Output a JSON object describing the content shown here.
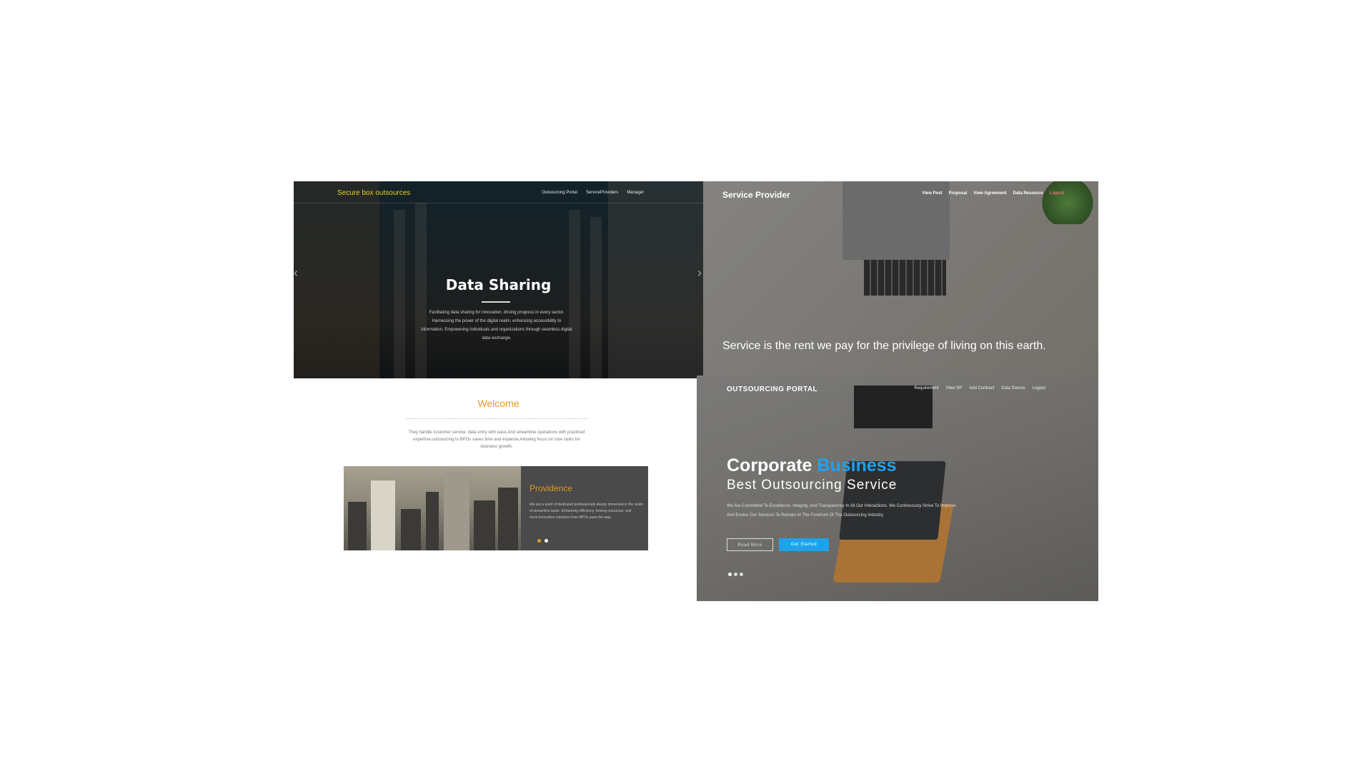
{
  "panel_secure_box": {
    "brand": "Secure box outsources",
    "nav": [
      "Outsourcing Portal",
      "ServiceProviders",
      "Manager"
    ],
    "hero_title": "Data Sharing",
    "hero_desc": "Facilitating data sharing for innovation, driving progress in every sector. Harnessing the power of the digital realm, enhancing accessibility to information. Empowering individuals and organizations through seamless digital data exchange."
  },
  "welcome": {
    "title": "Welcome",
    "desc": "They handle customer service, data entry with ease,And streamline operations with practiced expertise.outsourcing to BPOs saves time and expense,Allowing focus on core tasks for business growth."
  },
  "card": {
    "title": "Providence",
    "desc": "We are a team of dedicated professionals deeply immersed in the realm of streamline tasks. Enhancing efficiency, freeing resources, and more.Innovative solutions from BPOs pave the way.",
    "dot_colors": [
      "#e39b1f",
      "#ffffff"
    ]
  },
  "panel_service_provider": {
    "brand": "Service Provider",
    "nav": [
      "View Post",
      "Proposal",
      "View Agreement",
      "Data Resource"
    ],
    "logout": "Logout",
    "quote": "Service is the rent we pay for the privilege of living on this earth."
  },
  "panel_outsourcing": {
    "brand": "OUTSOURCING PORTAL",
    "nav": [
      "Requirement",
      "View SP",
      "Add Contract",
      "Data Source",
      "Logout"
    ],
    "headline_part1": "Corporate",
    "headline_part2": "Business",
    "subheadline": "Best Outsourcing Service",
    "desc": "We Are Committed To Excellence, Integrity, And Transparency In All Our Interactions. We Continuously Strive To Improve And Evolve Our Services To Remain At The Forefront Of The Outsourcing Industry.",
    "read_more": "Read More",
    "get_started": "Get Started",
    "accent_color": "#1ea2ee"
  }
}
